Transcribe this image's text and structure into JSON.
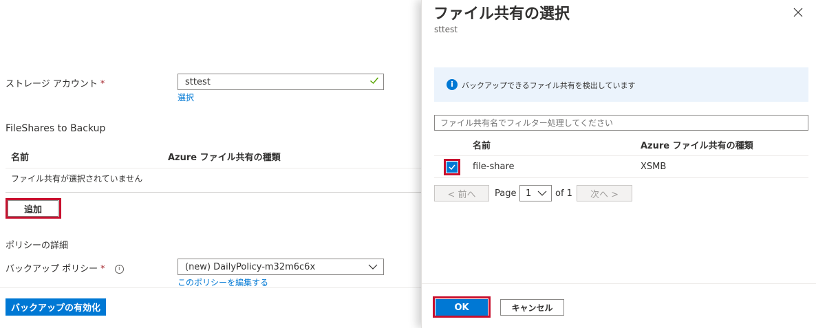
{
  "left": {
    "storage_account": {
      "label": "ストレージ アカウント",
      "required_mark": "*",
      "value": "sttest",
      "select_link": "選択"
    },
    "fileshares": {
      "heading": "FileShares to Backup",
      "columns": [
        "名前",
        "Azure ファイル共有の種類"
      ],
      "empty_message": "ファイル共有が選択されていません",
      "add_button": "追加"
    },
    "policy": {
      "heading": "ポリシーの詳細",
      "label": "バックアップ ポリシー",
      "required_mark": "*",
      "value": "(new) DailyPolicy-m32m6c6x",
      "edit_link": "このポリシーを編集する"
    },
    "enable_button": "バックアップの有効化"
  },
  "panel": {
    "title": "ファイル共有の選択",
    "subtitle": "sttest",
    "info_message": "バックアップできるファイル共有を検出しています",
    "filter_placeholder": "ファイル共有名でフィルター処理してください",
    "columns": [
      "名前",
      "Azure ファイル共有の種類"
    ],
    "rows": [
      {
        "name": "file-share",
        "type": "XSMB",
        "checked": true
      }
    ],
    "pagination": {
      "prev": "< 前へ",
      "page_label": "Page",
      "page_value": "1",
      "of_label": "of 1",
      "next": "次へ >"
    },
    "ok_button": "OK",
    "cancel_button": "キャンセル"
  },
  "colors": {
    "accent": "#0078d4",
    "highlight": "#c8102e",
    "info_bg": "#ebf3fc",
    "valid_check": "#57a300"
  }
}
